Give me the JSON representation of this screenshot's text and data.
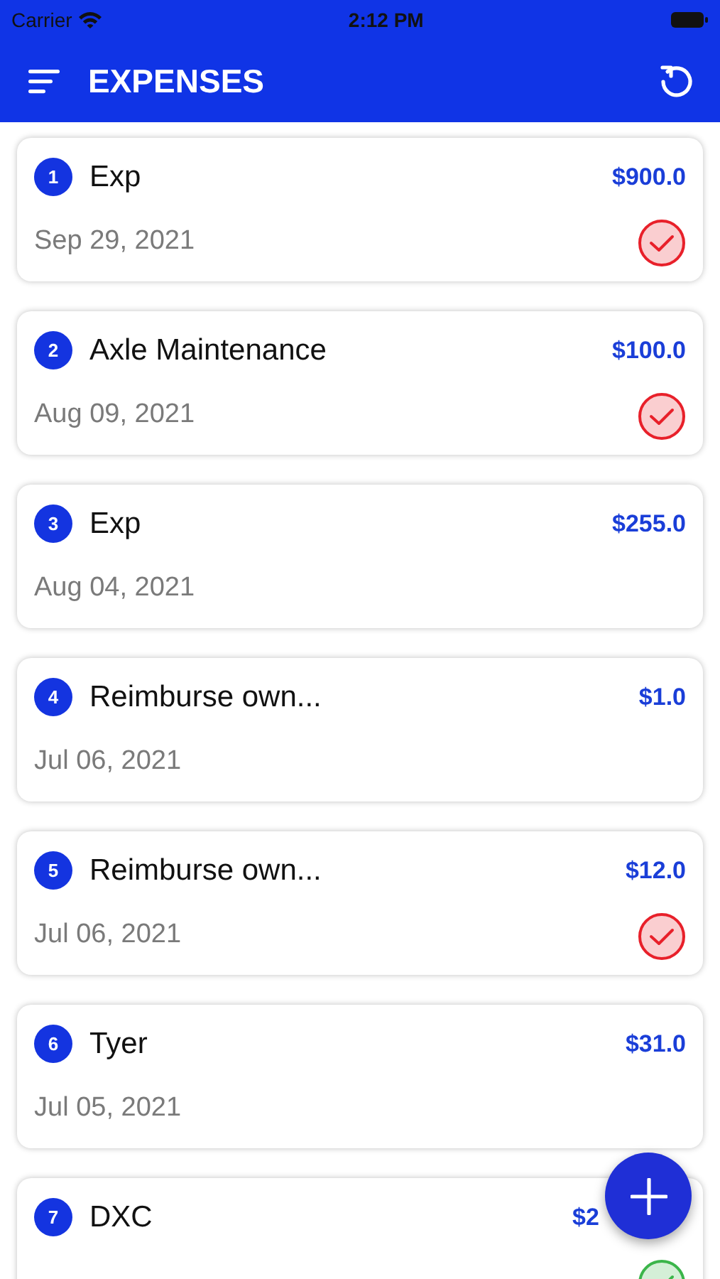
{
  "status_bar": {
    "carrier": "Carrier",
    "time": "2:12 PM"
  },
  "app_bar": {
    "title": "EXPENSES"
  },
  "expenses": [
    {
      "number": "1",
      "title": "Exp",
      "amount": "$900.0",
      "date": "Sep 29, 2021",
      "color": "#e8202a"
    },
    {
      "number": "2",
      "title": "Axle Maintenance",
      "amount": "$100.0",
      "date": "Aug 09, 2021",
      "color": "#e8202a"
    },
    {
      "number": "3",
      "title": "Exp",
      "amount": "$255.0",
      "date": "Aug 04, 2021"
    },
    {
      "number": "4",
      "title": "Reimburse own...",
      "amount": "$1.0",
      "date": "Jul 06, 2021"
    },
    {
      "number": "5",
      "title": "Reimburse own...",
      "amount": "$12.0",
      "date": "Jul 06, 2021",
      "color": "#e8202a"
    },
    {
      "number": "6",
      "title": "Tyer",
      "amount": "$31.0",
      "date": "Jul 05, 2021"
    },
    {
      "number": "7",
      "title": "DXC",
      "amount": "$2",
      "partly_hidden": true,
      "color": "#3bb54a"
    }
  ]
}
